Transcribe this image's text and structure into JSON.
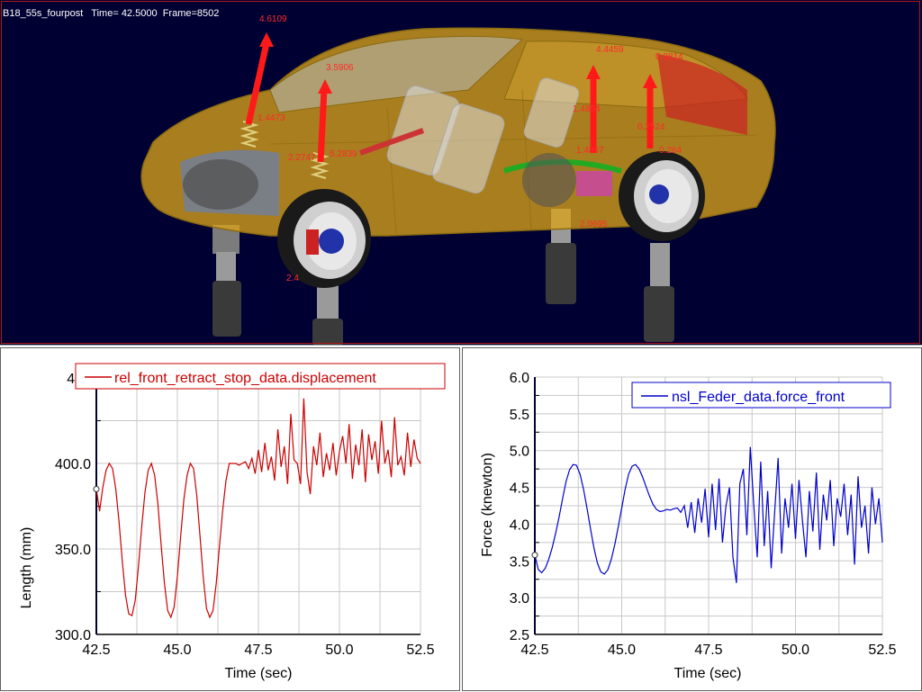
{
  "viewport": {
    "model_name": "B18_55s_fourpost",
    "time_label": "Time=",
    "time_value": "42.5000",
    "frame_label": "Frame=",
    "frame_value": "8502",
    "bg_color": "#000033",
    "car_color": "#d9a21a",
    "force_color": "#ff1a1a",
    "force_labels": [
      "4.6109",
      "3.5906",
      "1.4473",
      "2.2747",
      "5.2839",
      "4.4459",
      "0.3814",
      "1.4854",
      "0.2524",
      "1.4867",
      "0.264",
      "2.0695",
      "2.4"
    ]
  },
  "chart_data": [
    {
      "type": "line",
      "title": "",
      "xlabel": "Time (sec)",
      "ylabel": "Length (mm)",
      "xlim": [
        42.5,
        52.5
      ],
      "ylim": [
        300,
        450
      ],
      "xticks": [
        "42.5",
        "45.0",
        "47.5",
        "50.0",
        "52.5"
      ],
      "yticks": [
        "300.0",
        "350.0",
        "400.0",
        "450"
      ],
      "ytick_values": [
        300,
        350,
        400,
        450
      ],
      "grid": true,
      "legend_position": "top",
      "series": [
        {
          "name": "rel_front_retract_stop_data.displacement",
          "color": "#cc0000",
          "x": [
            42.5,
            42.6,
            42.7,
            42.8,
            42.9,
            43.0,
            43.1,
            43.2,
            43.3,
            43.4,
            43.5,
            43.6,
            43.7,
            43.8,
            43.9,
            44.0,
            44.1,
            44.2,
            44.3,
            44.4,
            44.5,
            44.6,
            44.7,
            44.8,
            44.9,
            45.0,
            45.1,
            45.2,
            45.3,
            45.4,
            45.5,
            45.6,
            45.7,
            45.8,
            45.9,
            46.0,
            46.1,
            46.2,
            46.3,
            46.4,
            46.5,
            46.6,
            46.7,
            46.8,
            46.9,
            47.0,
            47.1,
            47.2,
            47.3,
            47.4,
            47.5,
            47.6,
            47.7,
            47.8,
            47.9,
            48.0,
            48.1,
            48.2,
            48.3,
            48.4,
            48.5,
            48.6,
            48.7,
            48.8,
            48.9,
            49.0,
            49.1,
            49.2,
            49.3,
            49.4,
            49.5,
            49.6,
            49.7,
            49.8,
            49.9,
            50.0,
            50.1,
            50.2,
            50.3,
            50.4,
            50.5,
            50.6,
            50.7,
            50.8,
            50.9,
            51.0,
            51.1,
            51.2,
            51.3,
            51.4,
            51.5,
            51.6,
            51.7,
            51.8,
            51.9,
            52.0,
            52.1,
            52.2,
            52.3,
            52.4,
            52.5
          ],
          "y": [
            385,
            372,
            386,
            396,
            400,
            397,
            385,
            366,
            343,
            323,
            312,
            311,
            320,
            340,
            363,
            383,
            396,
            400,
            393,
            376,
            352,
            330,
            314,
            310,
            316,
            334,
            357,
            379,
            393,
            400,
            397,
            381,
            357,
            333,
            315,
            310,
            314,
            330,
            352,
            373,
            390,
            400,
            400,
            400,
            399,
            400,
            401,
            397,
            403,
            394,
            408,
            395,
            412,
            396,
            404,
            390,
            420,
            398,
            410,
            388,
            429,
            402,
            400,
            388,
            438,
            395,
            382,
            410,
            399,
            418,
            392,
            406,
            396,
            412,
            393,
            407,
            416,
            400,
            423,
            391,
            411,
            399,
            420,
            389,
            417,
            402,
            413,
            394,
            425,
            400,
            408,
            392,
            427,
            399,
            404,
            393,
            418,
            398,
            414,
            403,
            400
          ]
        }
      ]
    },
    {
      "type": "line",
      "title": "",
      "xlabel": "Time (sec)",
      "ylabel": "Force (knewton)",
      "xlim": [
        42.5,
        52.5
      ],
      "ylim": [
        2.5,
        6.0
      ],
      "xticks": [
        "42.5",
        "45.0",
        "47.5",
        "50.0",
        "52.5"
      ],
      "yticks": [
        "2.5",
        "3.0",
        "3.5",
        "4.0",
        "4.5",
        "5.0",
        "5.5",
        "6.0"
      ],
      "ytick_values": [
        2.5,
        3.0,
        3.5,
        4.0,
        4.5,
        5.0,
        5.5,
        6.0
      ],
      "grid": true,
      "legend_position": "top-right",
      "series": [
        {
          "name": "nsl_Feder_data.force_front",
          "color": "#0000cc",
          "x": [
            42.5,
            42.6,
            42.7,
            42.8,
            42.9,
            43.0,
            43.1,
            43.2,
            43.3,
            43.4,
            43.5,
            43.6,
            43.7,
            43.8,
            43.9,
            44.0,
            44.1,
            44.2,
            44.3,
            44.4,
            44.5,
            44.6,
            44.7,
            44.8,
            44.9,
            45.0,
            45.1,
            45.2,
            45.3,
            45.4,
            45.5,
            45.6,
            45.7,
            45.8,
            45.9,
            46.0,
            46.1,
            46.2,
            46.3,
            46.4,
            46.5,
            46.6,
            46.7,
            46.8,
            46.9,
            47.0,
            47.1,
            47.2,
            47.3,
            47.4,
            47.5,
            47.6,
            47.7,
            47.8,
            47.9,
            48.0,
            48.1,
            48.2,
            48.3,
            48.4,
            48.5,
            48.6,
            48.7,
            48.8,
            48.9,
            49.0,
            49.1,
            49.2,
            49.3,
            49.4,
            49.5,
            49.6,
            49.7,
            49.8,
            49.9,
            50.0,
            50.1,
            50.2,
            50.3,
            50.4,
            50.5,
            50.6,
            50.7,
            50.8,
            50.9,
            51.0,
            51.1,
            51.2,
            51.3,
            51.4,
            51.5,
            51.6,
            51.7,
            51.8,
            51.9,
            52.0,
            52.1,
            52.2,
            52.3,
            52.4,
            52.5
          ],
          "y": [
            3.58,
            3.38,
            3.34,
            3.4,
            3.52,
            3.68,
            3.88,
            4.1,
            4.35,
            4.58,
            4.74,
            4.81,
            4.8,
            4.68,
            4.48,
            4.22,
            3.94,
            3.68,
            3.47,
            3.35,
            3.32,
            3.38,
            3.52,
            3.72,
            3.96,
            4.22,
            4.48,
            4.68,
            4.79,
            4.81,
            4.75,
            4.64,
            4.51,
            4.38,
            4.27,
            4.2,
            4.17,
            4.18,
            4.2,
            4.19,
            4.21,
            4.22,
            4.16,
            4.25,
            3.95,
            4.3,
            3.88,
            4.35,
            4.02,
            4.48,
            3.82,
            4.55,
            3.92,
            4.62,
            3.75,
            4.25,
            4.5,
            3.55,
            3.2,
            4.55,
            4.75,
            3.85,
            5.05,
            4.25,
            3.55,
            4.85,
            3.7,
            4.45,
            3.4,
            4.15,
            4.9,
            3.6,
            4.35,
            3.95,
            4.55,
            3.8,
            4.6,
            4.05,
            3.55,
            4.45,
            3.9,
            4.7,
            3.65,
            4.4,
            4.05,
            4.6,
            3.7,
            4.35,
            4.1,
            4.55,
            3.85,
            4.4,
            3.45,
            4.65,
            3.95,
            4.25,
            3.6,
            4.5,
            4.0,
            4.35,
            3.75
          ]
        }
      ]
    }
  ]
}
